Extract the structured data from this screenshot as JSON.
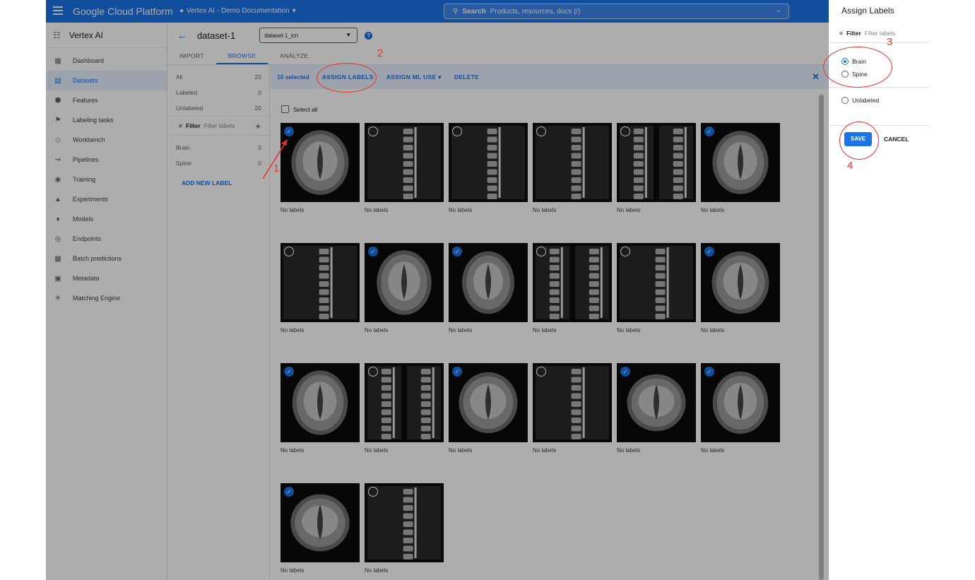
{
  "topbar": {
    "brand": "Google Cloud Platform",
    "project": "Vertex AI - Demo Documentation",
    "search_label": "Search",
    "search_placeholder": "Products, resources, docs (/)"
  },
  "nav": {
    "title": "Vertex AI",
    "items": [
      {
        "label": "Dashboard",
        "icon": "dashboard-icon"
      },
      {
        "label": "Datasets",
        "icon": "datasets-icon"
      },
      {
        "label": "Features",
        "icon": "features-icon"
      },
      {
        "label": "Labeling tasks",
        "icon": "labeling-icon"
      },
      {
        "label": "Workbench",
        "icon": "workbench-icon"
      },
      {
        "label": "Pipelines",
        "icon": "pipelines-icon"
      },
      {
        "label": "Training",
        "icon": "training-icon"
      },
      {
        "label": "Experiments",
        "icon": "experiments-icon"
      },
      {
        "label": "Models",
        "icon": "models-icon"
      },
      {
        "label": "Endpoints",
        "icon": "endpoints-icon"
      },
      {
        "label": "Batch predictions",
        "icon": "batch-icon"
      },
      {
        "label": "Metadata",
        "icon": "metadata-icon"
      },
      {
        "label": "Matching Engine",
        "icon": "matching-icon"
      }
    ]
  },
  "header": {
    "title": "dataset-1",
    "dataset_select": "dataset-1_icn"
  },
  "tabs": [
    "IMPORT",
    "BROWSE",
    "ANALYZE"
  ],
  "labels_panel": {
    "rows": [
      {
        "label": "All",
        "count": "20"
      },
      {
        "label": "Labeled",
        "count": "0"
      },
      {
        "label": "Unlabeled",
        "count": "20"
      }
    ],
    "filter_label": "Filter",
    "filter_placeholder": "Filter labels",
    "labels": [
      {
        "label": "Brain",
        "count": "0"
      },
      {
        "label": "Spine",
        "count": "0"
      }
    ],
    "add_label": "ADD NEW LABEL"
  },
  "action_bar": {
    "selected": "10 selected",
    "assign_labels": "ASSIGN LABELS",
    "assign_ml_use": "ASSIGN ML USE",
    "delete": "DELETE"
  },
  "select_all": "Select all",
  "images": [
    {
      "type": "brain",
      "checked": true,
      "caption": "No labels"
    },
    {
      "type": "spine",
      "checked": false,
      "caption": "No labels"
    },
    {
      "type": "spine",
      "checked": false,
      "caption": "No labels"
    },
    {
      "type": "spine",
      "checked": false,
      "caption": "No labels"
    },
    {
      "type": "spine",
      "checked": false,
      "caption": "No labels"
    },
    {
      "type": "brain",
      "checked": true,
      "caption": "No labels"
    },
    {
      "type": "spine",
      "checked": false,
      "caption": "No labels"
    },
    {
      "type": "brain",
      "checked": true,
      "caption": "No labels"
    },
    {
      "type": "brain",
      "checked": true,
      "caption": "No labels"
    },
    {
      "type": "spine",
      "checked": false,
      "caption": "No labels"
    },
    {
      "type": "spine",
      "checked": false,
      "caption": "No labels"
    },
    {
      "type": "brain",
      "checked": true,
      "caption": "No labels"
    },
    {
      "type": "brain",
      "checked": true,
      "caption": "No labels"
    },
    {
      "type": "spine",
      "checked": false,
      "caption": "No labels"
    },
    {
      "type": "brain",
      "checked": true,
      "caption": "No labels"
    },
    {
      "type": "spine",
      "checked": false,
      "caption": "No labels"
    },
    {
      "type": "brain",
      "checked": true,
      "caption": "No labels"
    },
    {
      "type": "brain",
      "checked": true,
      "caption": "No labels"
    },
    {
      "type": "brain",
      "checked": true,
      "caption": "No labels"
    },
    {
      "type": "spine",
      "checked": false,
      "caption": "No labels"
    }
  ],
  "assign_panel": {
    "title": "Assign Labels",
    "filter_label": "Filter",
    "filter_placeholder": "Filter labels",
    "options": [
      {
        "label": "Brain",
        "selected": true
      },
      {
        "label": "Spine",
        "selected": false
      }
    ],
    "unlabeled": "Unlabeled",
    "save": "SAVE",
    "cancel": "CANCEL"
  },
  "annotations": [
    "1",
    "2",
    "3",
    "4"
  ],
  "colors": {
    "accent": "#1a73e8",
    "annotation": "#e8332a",
    "selection_bar": "#e8f0fe"
  }
}
